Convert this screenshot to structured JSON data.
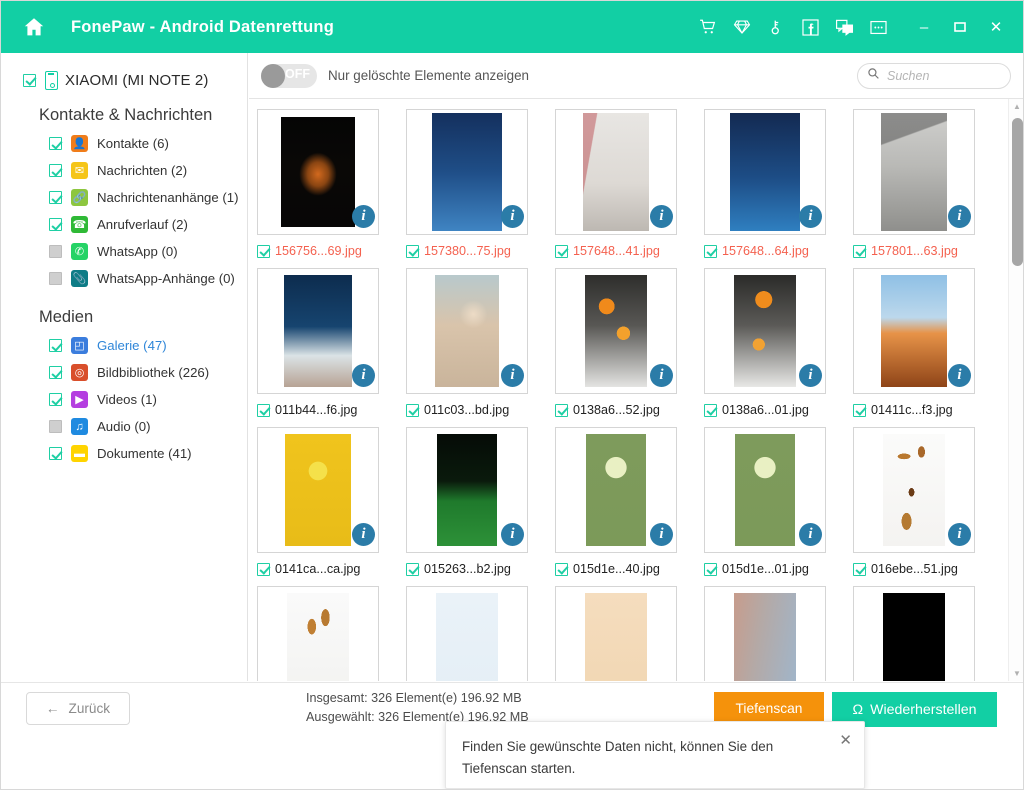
{
  "titlebar": {
    "title": "FonePaw - Android Datenrettung",
    "home_icon": "home-icon",
    "icons": [
      "cart-icon",
      "diamond-icon",
      "key-icon",
      "facebook-icon",
      "feedback-icon",
      "more-icon"
    ],
    "window_controls": {
      "minimize": "–",
      "maximize": "❐",
      "close": "✕"
    },
    "bg_color": "#12cfa4"
  },
  "sidebar": {
    "device": {
      "label": "XIAOMI (MI NOTE 2)",
      "checked": true,
      "icon": "phone-icon"
    },
    "groups": [
      {
        "title": "Kontakte & Nachrichten",
        "items": [
          {
            "label": "Kontakte (6)",
            "checked": true,
            "icon": "contact-icon",
            "color": "#f07d1a",
            "glyph": "👤"
          },
          {
            "label": "Nachrichten (2)",
            "checked": true,
            "icon": "message-icon",
            "color": "#f5c518",
            "glyph": "✉"
          },
          {
            "label": "Nachrichtenanhänge (1)",
            "checked": true,
            "icon": "attachment-icon",
            "color": "#8dc63f",
            "glyph": "🔗"
          },
          {
            "label": "Anrufverlauf (2)",
            "checked": true,
            "icon": "call-history-icon",
            "color": "#2fb936",
            "glyph": "☎"
          },
          {
            "label": "WhatsApp (0)",
            "checked": false,
            "icon": "whatsapp-icon",
            "color": "#25d366",
            "glyph": "✆"
          },
          {
            "label": "WhatsApp-Anhänge (0)",
            "checked": false,
            "icon": "whatsapp-attachment-icon",
            "color": "#0e7c86",
            "glyph": "📎"
          }
        ]
      },
      {
        "title": "Medien",
        "items": [
          {
            "label": "Galerie (47)",
            "checked": true,
            "selected": true,
            "icon": "gallery-icon",
            "color": "#3b7ddd",
            "glyph": "◰"
          },
          {
            "label": "Bildbibliothek (226)",
            "checked": true,
            "icon": "picture-library-icon",
            "color": "#d94f2b",
            "glyph": "◎"
          },
          {
            "label": "Videos (1)",
            "checked": true,
            "icon": "video-icon",
            "color": "#b43ee0",
            "glyph": "▶"
          },
          {
            "label": "Audio (0)",
            "checked": false,
            "icon": "audio-icon",
            "color": "#1f8ae0",
            "glyph": "♫"
          },
          {
            "label": "Dokumente (41)",
            "checked": true,
            "icon": "documents-icon",
            "color": "#ffd400",
            "glyph": "▬"
          }
        ]
      }
    ]
  },
  "toolbar": {
    "toggle_state": "OFF",
    "toggle_label": "Nur gelöschte Elemente anzeigen",
    "search_placeholder": "Suchen",
    "search_value": "",
    "search_icon": "search-icon"
  },
  "gallery": {
    "info_glyph": "i",
    "items": [
      {
        "name": "156756...69.jpg",
        "checked": true,
        "deleted": true,
        "pic": "linear-gradient(180deg,#050505 0%,#0a0806 45%,#070606 100%)",
        "pw": 74,
        "ph": 110,
        "overlay": "radial-gradient(ellipse 26px 30px at 50% 52%, #d2691e 0%, #8a4512 40%, rgba(12,8,4,0) 72%)"
      },
      {
        "name": "157380...75.jpg",
        "checked": true,
        "deleted": true,
        "pic": "linear-gradient(180deg,#14305e 0%,#1f4e87 50%,#3f84c2 100%)",
        "pw": 70,
        "ph": 118,
        "overlay": ""
      },
      {
        "name": "157648...41.jpg",
        "checked": true,
        "deleted": true,
        "pic": "linear-gradient(180deg,#e8e6e3 0%,#ddd9d4 60%,#bdb8b2 100%)",
        "pw": 66,
        "ph": 118,
        "overlay": "linear-gradient(100deg, rgba(190,90,95,0.55) 0 16%, rgba(255,255,255,0) 17% 100%)"
      },
      {
        "name": "157648...64.jpg",
        "checked": true,
        "deleted": true,
        "pic": "linear-gradient(180deg,#132a52 0%,#1d4d86 55%,#2f7fc0 100%)",
        "pw": 70,
        "ph": 118,
        "overlay": ""
      },
      {
        "name": "157801...63.jpg",
        "checked": true,
        "deleted": true,
        "pic": "linear-gradient(180deg,#cfcfcd 0%,#b9b9b6 45%,#8f8f8c 100%)",
        "pw": 66,
        "ph": 118,
        "overlay": "linear-gradient(160deg, rgba(60,60,60,0.45) 0 22%, rgba(255,255,255,0) 23% 100%)"
      },
      {
        "name": "011b44...f6.jpg",
        "checked": true,
        "deleted": false,
        "pic": "linear-gradient(180deg,#0d2c4e 0%,#16446f 46%,#dbe3e6 72%,#b7a394 100%)",
        "pw": 68,
        "ph": 112,
        "overlay": ""
      },
      {
        "name": "011c03...bd.jpg",
        "checked": true,
        "deleted": false,
        "pic": "linear-gradient(180deg,#b8c9cc 0%,#d9c4ab 45%,#c9b49b 100%)",
        "pw": 64,
        "ph": 112,
        "overlay": "radial-gradient(circle 20px at 60% 35%, rgba(240,222,200,0.9), rgba(0,0,0,0) 70%)"
      },
      {
        "name": "0138a6...52.jpg",
        "checked": true,
        "deleted": false,
        "pic": "linear-gradient(180deg,#2e2e2c 0%,#585754 45%,#e4e4e2 100%)",
        "pw": 62,
        "ph": 112,
        "overlay": "radial-gradient(circle 13px at 35% 28%, #f08a1b 60%, rgba(0,0,0,0) 62%), radial-gradient(circle 11px at 62% 52%, #f3a12c 60%, rgba(0,0,0,0) 62%)"
      },
      {
        "name": "0138a6...01.jpg",
        "checked": true,
        "deleted": false,
        "pic": "linear-gradient(180deg,#2b2b29 0%,#5b5a57 45%,#e8e8e6 100%)",
        "pw": 62,
        "ph": 112,
        "overlay": "radial-gradient(circle 14px at 48% 22%, #ef8c1d 60%, rgba(0,0,0,0) 62%), radial-gradient(circle 10px at 40% 62%, #f2a232 60%, rgba(0,0,0,0) 62%)"
      },
      {
        "name": "01411c...f3.jpg",
        "checked": true,
        "deleted": false,
        "pic": "linear-gradient(180deg,#8fc0e5 0%,#bcd8ec 38%,#e79348 52%,#8e4418 100%)",
        "pw": 66,
        "ph": 112,
        "overlay": ""
      },
      {
        "name": "0141ca...ca.jpg",
        "checked": true,
        "deleted": false,
        "pic": "linear-gradient(180deg,#f0c41d 0%,#e8bc18 100%)",
        "pw": 66,
        "ph": 112,
        "overlay": "radial-gradient(circle 14px at 50% 33%, #f5e14a 65%, rgba(0,0,0,0) 68%)"
      },
      {
        "name": "015263...b2.jpg",
        "checked": true,
        "deleted": false,
        "pic": "linear-gradient(180deg,#050b06 0%,#0a1a0c 42%,#1f7a2c 60%,#2d9138 100%)",
        "pw": 60,
        "ph": 112,
        "overlay": ""
      },
      {
        "name": "015d1e...40.jpg",
        "checked": true,
        "deleted": false,
        "pic": "linear-gradient(180deg,#7e9b5c 0%,#7c9a59 100%)",
        "pw": 60,
        "ph": 112,
        "overlay": "radial-gradient(circle 16px at 50% 30%, #e9f0c3 65%, rgba(0,0,0,0) 68%)"
      },
      {
        "name": "015d1e...01.jpg",
        "checked": true,
        "deleted": false,
        "pic": "linear-gradient(180deg,#7e9b5c 0%,#7c9a59 100%)",
        "pw": 60,
        "ph": 112,
        "overlay": "radial-gradient(circle 16px at 50% 30%, #e9f0c3 65%, rgba(0,0,0,0) 68%)"
      },
      {
        "name": "016ebe...51.jpg",
        "checked": true,
        "deleted": false,
        "pic": "linear-gradient(180deg,#fbfbfa 0%,#f4f3f1 100%)",
        "pw": 62,
        "ph": 112,
        "overlay": "radial-gradient(ellipse 9px 4px at 34% 20%, #b9782e 70%, rgba(0,0,0,0) 72%), radial-gradient(ellipse 5px 8px at 62% 16%, #a9682a 70%, rgba(0,0,0,0) 72%), radial-gradient(ellipse 4px 6px at 46% 52%, #6b3b16 70%, rgba(0,0,0,0) 72%), radial-gradient(ellipse 7px 12px at 38% 78%, #b57a32 70%, rgba(0,0,0,0) 72%)"
      },
      {
        "name": "",
        "checked": false,
        "deleted": false,
        "partial": true,
        "pic": "linear-gradient(180deg,#fafafa 0%,#f2f2f0 100%)",
        "pw": 62,
        "ph": 112,
        "overlay": "radial-gradient(ellipse 6px 11px at 40% 30%, #c07f33 70%, rgba(0,0,0,0) 72%), radial-gradient(ellipse 6px 12px at 62% 22%, #b87a31 70%, rgba(0,0,0,0) 72%)"
      },
      {
        "name": "",
        "checked": false,
        "deleted": false,
        "partial": true,
        "pic": "linear-gradient(180deg,#eaf2f8 0%,#e4eef6 100%)",
        "pw": 62,
        "ph": 112,
        "overlay": ""
      },
      {
        "name": "",
        "checked": false,
        "deleted": false,
        "partial": true,
        "pic": "linear-gradient(180deg,#f5ddbe 0%,#f1d6b2 100%)",
        "pw": 62,
        "ph": 112,
        "overlay": ""
      },
      {
        "name": "",
        "checked": false,
        "deleted": false,
        "partial": true,
        "pic": "linear-gradient(100deg,#c79c8c 0%,#b4a9a6 40%,#9fb6cc 100%)",
        "pw": 62,
        "ph": 112,
        "overlay": ""
      },
      {
        "name": "",
        "checked": false,
        "deleted": false,
        "partial": true,
        "pic": "linear-gradient(180deg,#000000 0%,#000000 100%)",
        "pw": 62,
        "ph": 112,
        "overlay": ""
      }
    ]
  },
  "bottombar": {
    "back_label": "Zurück",
    "back_arrow": "←",
    "total_text": "Insgesamt: 326 Element(e) 196.92 MB",
    "selected_text": "Ausgewählt: 326 Element(e) 196.92 MB",
    "deep_scan_label": "Tiefenscan",
    "recover_label": "Wiederherstellen",
    "recover_icon": "Ω",
    "deep_scan_color": "#f5920b",
    "recover_color": "#12cfa4"
  },
  "tooltip": {
    "text": "Finden Sie gewünschte Daten nicht, können Sie den Tiefenscan starten.",
    "close": "✕"
  }
}
